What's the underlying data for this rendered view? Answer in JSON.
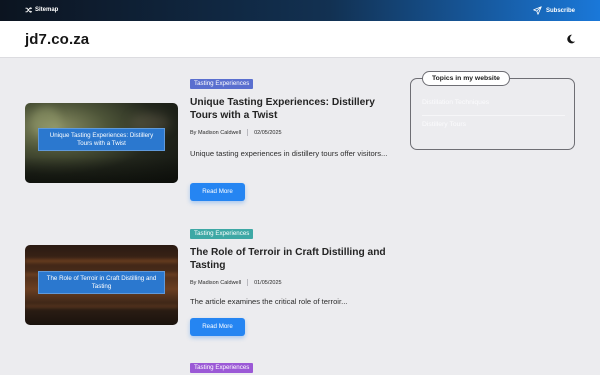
{
  "topbar": {
    "sitemap_label": "Sitemap",
    "subscribe_label": "Subscribe",
    "sitemap_icon": "shuffle-icon",
    "subscribe_icon": "send-icon"
  },
  "header": {
    "logo": "jd7.co.za",
    "theme_icon": "moon-icon"
  },
  "posts": [
    {
      "category": "Tasting Experiences",
      "category_color": "#5a6fcf",
      "title": "Unique Tasting Experiences: Distillery Tours with a Twist",
      "thumbnail_caption": "Unique Tasting Experiences: Distillery Tours with a Twist",
      "author": "By Madison Caldwell",
      "date": "02/05/2025",
      "excerpt": "Unique tasting experiences in distillery tours offer visitors...",
      "read_more": "Read More"
    },
    {
      "category": "Tasting Experiences",
      "category_color": "#3ea8a5",
      "title": "The Role of Terroir in Craft Distilling and Tasting",
      "thumbnail_caption": "The Role of Terroir in Craft Distilling and Tasting",
      "author": "By Madison Caldwell",
      "date": "01/05/2025",
      "excerpt": "The article examines the critical role of terroir...",
      "read_more": "Read More"
    },
    {
      "category": "Tasting Experiences",
      "category_color": "#9b59d6"
    }
  ],
  "sidebar": {
    "widget_title": "Topics in my website",
    "items": [
      {
        "label": "Distillation Techniques"
      },
      {
        "label": "Distillery Tours"
      }
    ]
  }
}
